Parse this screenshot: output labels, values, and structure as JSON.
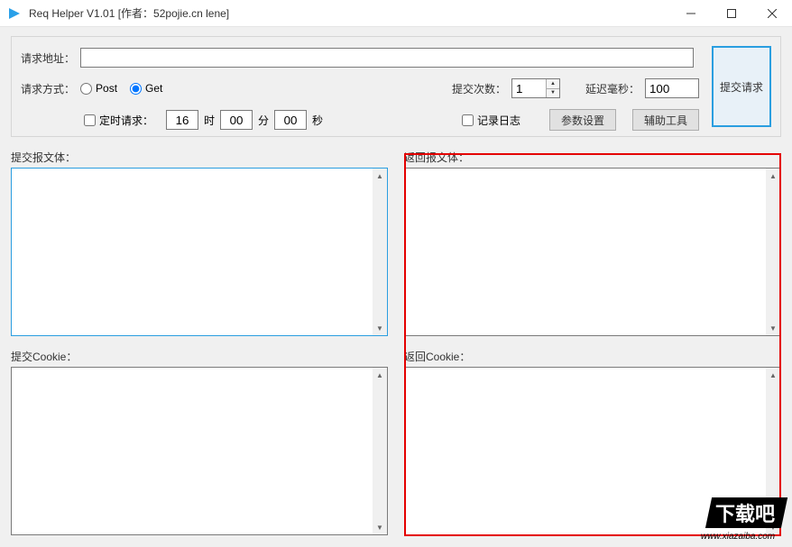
{
  "window": {
    "title": "Req Helper V1.01    [作者：52pojie.cn lene]"
  },
  "top": {
    "url_label": "请求地址：",
    "url_value": "",
    "method_label": "请求方式：",
    "post_label": "Post",
    "get_label": "Get",
    "method_selected": "get",
    "times_label": "提交次数：",
    "times_value": "1",
    "delay_label": "延迟毫秒：",
    "delay_value": "100",
    "submit_button": "提交请求",
    "timed_checkbox": "定时请求：",
    "timed_checked": false,
    "hour_value": "16",
    "hour_unit": "时",
    "minute_value": "00",
    "minute_unit": "分",
    "second_value": "00",
    "second_unit": "秒",
    "log_checkbox": "记录日志",
    "log_checked": false,
    "param_button": "参数设置",
    "tool_button": "辅助工具"
  },
  "left": {
    "body_label": "提交报文体：",
    "body_value": "",
    "cookie_label": "提交Cookie：",
    "cookie_value": ""
  },
  "right": {
    "body_label": "返回报文体：",
    "body_value": "",
    "cookie_label": "返回Cookie：",
    "cookie_value": ""
  },
  "watermark": {
    "line1": "下载吧",
    "line2": "www.xiazaiba.com"
  }
}
